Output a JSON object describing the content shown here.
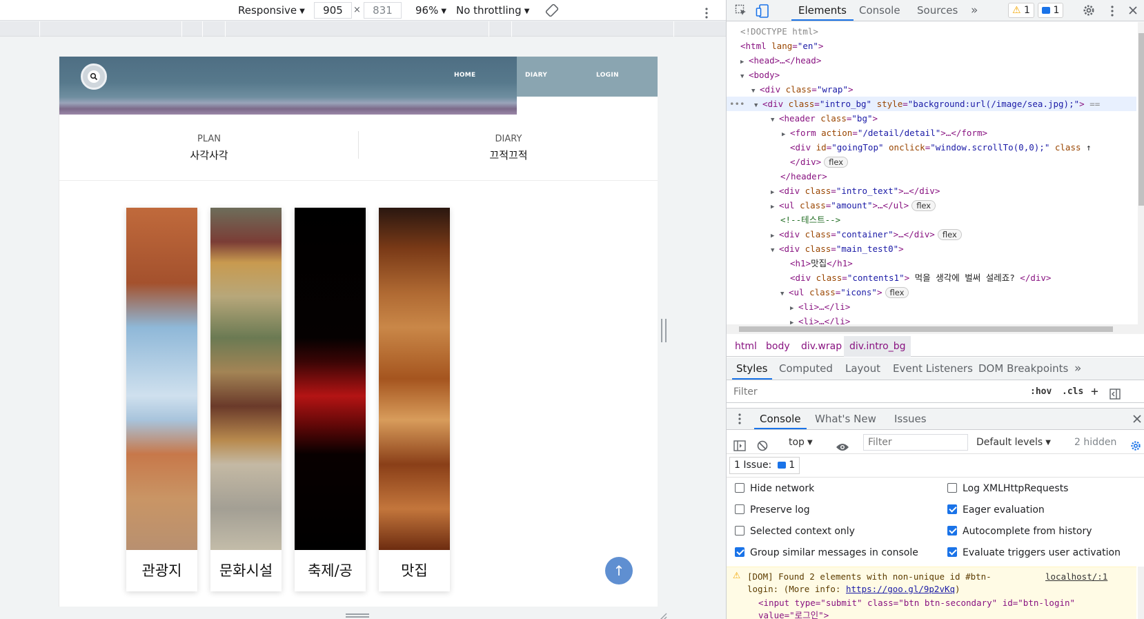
{
  "device_toolbar": {
    "device": "Responsive",
    "width": "905",
    "times": "×",
    "height": "831",
    "zoom": "96%",
    "throttling": "No throttling"
  },
  "site": {
    "nav": [
      "HOME",
      "DIARY",
      "LOGIN"
    ],
    "plan_en": "PLAN",
    "plan_ko": "사각사각",
    "diary_en": "DIARY",
    "diary_ko": "끄적끄적",
    "cards": [
      "관광지",
      "문화시설",
      "축제/공",
      "맛집"
    ],
    "top_button": "↑"
  },
  "devtools": {
    "tabs": [
      "Elements",
      "Console",
      "Sources"
    ],
    "more": "»",
    "warnings": "1",
    "messages": "1",
    "dom": {
      "doctype": "<!DOCTYPE html>",
      "html_tag": "<html ",
      "html_attr": "lang",
      "html_val": "\"en\"",
      "head": "<head>…</head>",
      "body": "<body>",
      "wrap_tag": "<div ",
      "wrap_attr": "class",
      "wrap_val": "\"wrap\"",
      "intro_tag": "<div ",
      "intro_attr1": "class",
      "intro_val1": "\"intro_bg\"",
      "intro_attr2": "style",
      "intro_val2": "\"background:url(/image/sea.jpg);\"",
      "intro_eq": "==",
      "header_tag": "<header ",
      "header_attr": "class",
      "header_val": "\"bg\"",
      "form_tag": "<form ",
      "form_attr": "action",
      "form_val": "\"/detail/detail\"",
      "form_end": ">…</form>",
      "top_tag": "<div ",
      "top_attr1": "id",
      "top_val1": "\"goingTop\"",
      "top_attr2": "onclick",
      "top_val2": "\"window.scrollTo(0,0);\"",
      "top_attr3": "class",
      "div_close": "</div>",
      "flex": "flex",
      "header_close": "</header>",
      "introtext_val": "\"intro_text\"",
      "amount_val": "\"amount\"",
      "ul_end": ">…</ul>",
      "comment": "<!--테스트-->",
      "container_val": "\"container\"",
      "main_val": "\"main_test0\"",
      "h1_open": "<h1>",
      "h1_text": "맛집",
      "h1_close": "</h1>",
      "contents_val": "\"contents1\"",
      "contents_text": " 먹을 생각에 벌써 설레죠? ",
      "icons_val": "\"icons\"",
      "li1": "<li>…</li>",
      "li2": "<li>…</li>"
    },
    "breadcrumbs": [
      "html",
      "body",
      "div.wrap",
      "div.intro_bg"
    ],
    "styles_tabs": [
      "Styles",
      "Computed",
      "Layout",
      "Event Listeners",
      "DOM Breakpoints"
    ],
    "styles_filter_placeholder": "Filter",
    "hov": ":hov",
    "cls": ".cls",
    "drawer_tabs": [
      "Console",
      "What's New",
      "Issues"
    ],
    "console_context": "top",
    "console_filter_placeholder": "Filter",
    "default_levels": "Default levels",
    "hidden": "2 hidden",
    "issue_label": "1 Issue:",
    "issue_count": "1",
    "settings_left": [
      {
        "label": "Hide network",
        "checked": false
      },
      {
        "label": "Preserve log",
        "checked": false
      },
      {
        "label": "Selected context only",
        "checked": false
      },
      {
        "label": "Group similar messages in console",
        "checked": true
      }
    ],
    "settings_right": [
      {
        "label": "Log XMLHttpRequests",
        "checked": false
      },
      {
        "label": "Eager evaluation",
        "checked": true
      },
      {
        "label": "Autocomplete from history",
        "checked": true
      },
      {
        "label": "Evaluate triggers user activation",
        "checked": true
      }
    ],
    "warning": {
      "line1": "[DOM] Found 2 elements with non-unique id #btn-",
      "line2_prefix": "login: (More info: ",
      "link": "https://goo.gl/9p2vKq",
      "line2_suffix": ")",
      "source": "localhost/:1",
      "line3": "<input type=\"submit\" class=\"btn btn-secondary\" id=\"btn-login\"",
      "line4": "value=\"로그인\">"
    },
    "colors": {
      "accent": "#1a73e8",
      "tag": "#881280",
      "attr": "#994500",
      "value": "#1a1aa6"
    }
  }
}
